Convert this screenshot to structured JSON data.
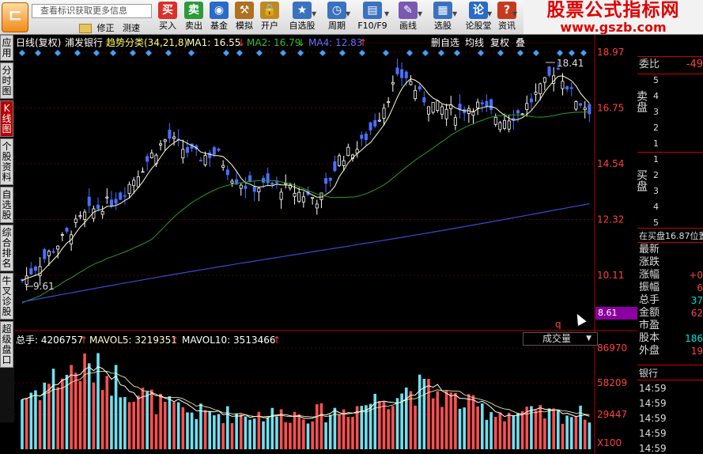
{
  "toolbar": {
    "search_placeholder": "查看标识获取更多信息",
    "small_links": [
      "修正",
      "测速"
    ],
    "buttons": [
      {
        "label": "买入",
        "icon": "买",
        "color": "#d8302a"
      },
      {
        "label": "卖出",
        "icon": "卖",
        "color": "#2c9a3a"
      },
      {
        "label": "基金",
        "icon": "◉",
        "color": "#2a6ac8"
      },
      {
        "label": "模拟",
        "icon": "⚒",
        "color": "#b07020"
      },
      {
        "label": "开户",
        "icon": "🔒",
        "color": "#c08a20"
      },
      {
        "label": "自选股",
        "icon": "★",
        "color": "#3a72c0"
      },
      {
        "label": "周期",
        "icon": "◷",
        "color": "#3a72c0"
      },
      {
        "label": "F10/F9",
        "icon": "▤",
        "color": "#3a72c0"
      },
      {
        "label": "画线",
        "icon": "✎",
        "color": "#7a5ab0"
      },
      {
        "label": "选股",
        "icon": "▦",
        "color": "#3a72c0"
      },
      {
        "label": "论股堂",
        "icon": "论",
        "color": "#2a6ac8"
      },
      {
        "label": "资讯",
        "icon": "?",
        "color": "#c83a20"
      }
    ],
    "brand_title": "股票公式指标网",
    "brand_url": "www.gszb.com"
  },
  "sidebar": {
    "tabs": [
      {
        "label": "应用"
      },
      {
        "label": "分时图"
      },
      {
        "label": "K线图",
        "active": true
      },
      {
        "label": "个股资料"
      },
      {
        "label": "自选股"
      },
      {
        "label": "综合排名"
      },
      {
        "label": "牛叉诊股"
      },
      {
        "label": "超级盘口"
      }
    ]
  },
  "chart": {
    "header": {
      "title": "日线(复权)",
      "stock_name": "浦发银行",
      "indicator": "趋势分类(34,21,8)",
      "ma1": "MA1: 16.55",
      "ma2": "MA2: 16.79",
      "ma4": "MA4: 12.83"
    },
    "header_right": [
      "删自选",
      "均线",
      "复权",
      "叠"
    ],
    "price_labels": [
      "18.97",
      "16.75",
      "14.54",
      "12.32",
      "10.11",
      "8.61"
    ],
    "current_price_tag": "8.61",
    "peak_label": "18.41",
    "low_label": "9.61",
    "marker_q": "q",
    "volume": {
      "total": "总手: 4206757",
      "mavol5": "MAVOL5: 3219351",
      "mavol10": "MAVOL10: 3513466",
      "select_label": "成交量",
      "axis_labels": [
        "86970",
        "58209",
        "29447",
        "X100"
      ]
    },
    "colors": {
      "up": "#ff4040",
      "down": "#4a70ff",
      "ma_short": "#ffffcc",
      "ma_mid": "#2a9a2a",
      "ma_long": "#3a4ad0",
      "vol_up": "#ff5050",
      "vol_down": "#70e0f0"
    }
  },
  "quote_panel": {
    "weibi_label": "委比",
    "weibi_value": "-49",
    "sell_label": "卖盘",
    "buy_label": "买盘",
    "sell_levels": [
      "5",
      "4",
      "3",
      "2",
      "1"
    ],
    "buy_levels": [
      "1",
      "2",
      "3",
      "4",
      "5"
    ],
    "status_text": "在买盘16.87位置",
    "rows": [
      {
        "label": "最新",
        "value": ""
      },
      {
        "label": "涨跌",
        "value": ""
      },
      {
        "label": "涨幅",
        "value": "+0"
      },
      {
        "label": "振幅",
        "value": "6"
      },
      {
        "label": "总手",
        "value": "37"
      },
      {
        "label": "金额",
        "value": "62"
      },
      {
        "label": "市盈",
        "value": ""
      },
      {
        "label": "股本",
        "value": "186"
      },
      {
        "label": "外盘",
        "value": "19"
      }
    ],
    "section_label": "银行",
    "tick_times": [
      "14:59",
      "14:59",
      "14:59",
      "14:59",
      "14:59"
    ]
  }
}
